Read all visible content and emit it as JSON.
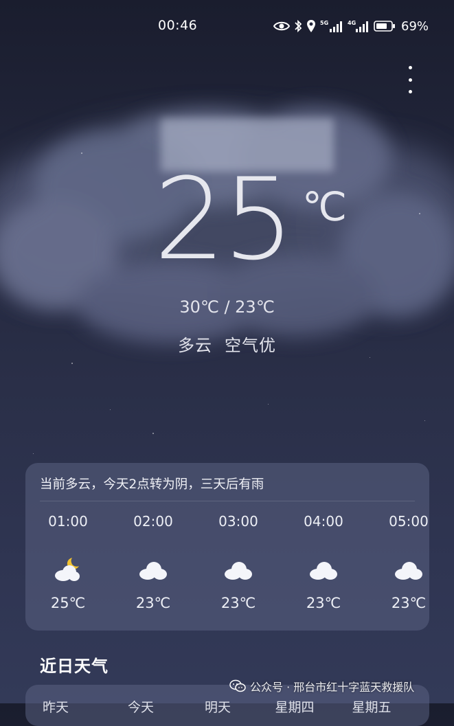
{
  "status_bar": {
    "time": "00:46",
    "battery_percent": "69%",
    "network_label_1": "5G",
    "network_label_2": "4G"
  },
  "current": {
    "temperature": "25",
    "unit": "℃",
    "range": "30℃ / 23℃",
    "condition": "多云",
    "air_quality": "空气优"
  },
  "hourly": {
    "summary": "当前多云，今天2点转为阴，三天后有雨",
    "items": [
      {
        "time": "01:00",
        "icon": "moon-cloud-icon",
        "temp": "25℃"
      },
      {
        "time": "02:00",
        "icon": "cloud-icon",
        "temp": "23℃"
      },
      {
        "time": "03:00",
        "icon": "cloud-icon",
        "temp": "23℃"
      },
      {
        "time": "04:00",
        "icon": "cloud-icon",
        "temp": "23℃"
      },
      {
        "time": "05:00",
        "icon": "cloud-icon",
        "temp": "23℃"
      }
    ]
  },
  "daily": {
    "title": "近日天气",
    "tabs": [
      "昨天",
      "今天",
      "明天",
      "星期四",
      "星期五"
    ]
  },
  "watermark": {
    "text": "公众号 · 邢台市红十字蓝天救援队"
  },
  "colors": {
    "background_top": "#1a1d2e",
    "background_bottom": "#333a58",
    "card": "#5c6484",
    "sun": "#f2c230"
  }
}
